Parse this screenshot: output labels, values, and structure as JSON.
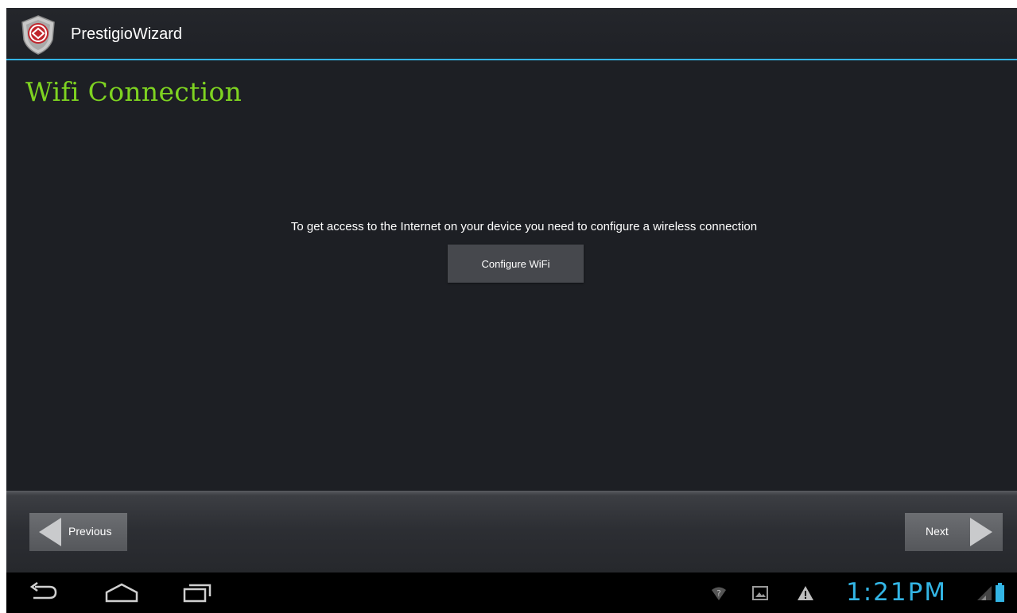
{
  "app_bar": {
    "title": "PrestigioWizard",
    "icon": "prestigio-shield-icon",
    "accent_color": "#33b5e5"
  },
  "main": {
    "title": "Wifi Connection",
    "title_color": "#7ed321",
    "description": "To get access to the Internet on your device you need to configure a wireless connection",
    "configure_button": "Configure WiFi"
  },
  "wizard_nav": {
    "previous_label": "Previous",
    "next_label": "Next"
  },
  "system_bar": {
    "nav_icons": [
      "back-icon",
      "home-icon",
      "recents-icon"
    ],
    "status_icons": [
      "wifi-question-icon",
      "gallery-icon",
      "warning-icon",
      "signal-icon",
      "battery-icon"
    ],
    "clock": "1:21PM",
    "clock_color": "#33b5e5"
  }
}
